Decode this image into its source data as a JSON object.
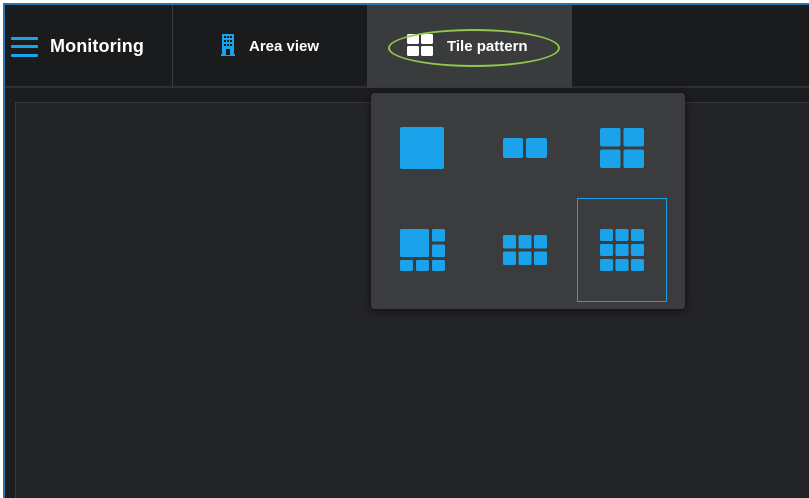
{
  "app": {
    "title": "Monitoring",
    "menu_icon": "hamburger-menu-icon"
  },
  "tabs": [
    {
      "label": "Area view",
      "icon": "building-icon",
      "active": false
    },
    {
      "label": "Tile pattern",
      "icon": "tile-grid-icon",
      "active": true
    }
  ],
  "tile_pattern_menu": {
    "options": [
      {
        "name": "1x1",
        "icon": "layout-1x1-icon",
        "selected": false
      },
      {
        "name": "1x2",
        "icon": "layout-1x2-icon",
        "selected": false
      },
      {
        "name": "2x2",
        "icon": "layout-2x2-icon",
        "selected": false
      },
      {
        "name": "1+7",
        "icon": "layout-1-plus-7-icon",
        "selected": false
      },
      {
        "name": "2x3",
        "icon": "layout-2x3-icon",
        "selected": false
      },
      {
        "name": "3x3",
        "icon": "layout-3x3-icon",
        "selected": true
      }
    ]
  },
  "colors": {
    "accent": "#1aa3ea",
    "highlight_ring": "#8fc84a",
    "background": "#1c1d1f",
    "menu_background": "#3b3c3e"
  }
}
